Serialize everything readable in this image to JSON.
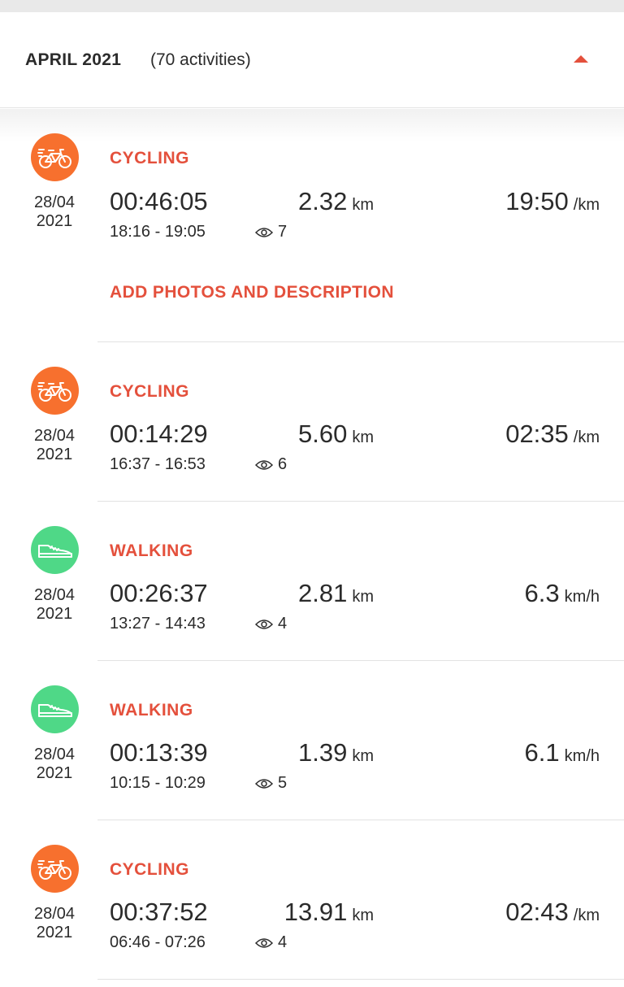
{
  "month": {
    "title": "APRIL 2021",
    "count": "(70 activities)"
  },
  "colors": {
    "accent": "#e4503c",
    "cycling": "#f7702e",
    "walking": "#4fd887"
  },
  "activities": [
    {
      "type": "CYCLING",
      "icon": "bicycle-icon",
      "date_day": "28/04",
      "date_year": "2021",
      "duration": "00:46:05",
      "distance": "2.32",
      "distance_unit": "km",
      "pace": "19:50",
      "pace_unit": "/km",
      "time_range": "18:16 - 19:05",
      "views": "7",
      "action": "ADD PHOTOS AND DESCRIPTION"
    },
    {
      "type": "CYCLING",
      "icon": "bicycle-icon",
      "date_day": "28/04",
      "date_year": "2021",
      "duration": "00:14:29",
      "distance": "5.60",
      "distance_unit": "km",
      "pace": "02:35",
      "pace_unit": "/km",
      "time_range": "16:37 - 16:53",
      "views": "6"
    },
    {
      "type": "WALKING",
      "icon": "shoe-icon",
      "date_day": "28/04",
      "date_year": "2021",
      "duration": "00:26:37",
      "distance": "2.81",
      "distance_unit": "km",
      "pace": "6.3",
      "pace_unit": "km/h",
      "time_range": "13:27 - 14:43",
      "views": "4"
    },
    {
      "type": "WALKING",
      "icon": "shoe-icon",
      "date_day": "28/04",
      "date_year": "2021",
      "duration": "00:13:39",
      "distance": "1.39",
      "distance_unit": "km",
      "pace": "6.1",
      "pace_unit": "km/h",
      "time_range": "10:15 - 10:29",
      "views": "5"
    },
    {
      "type": "CYCLING",
      "icon": "bicycle-icon",
      "date_day": "28/04",
      "date_year": "2021",
      "duration": "00:37:52",
      "distance": "13.91",
      "distance_unit": "km",
      "pace": "02:43",
      "pace_unit": "/km",
      "time_range": "06:46 - 07:26",
      "views": "4"
    }
  ]
}
